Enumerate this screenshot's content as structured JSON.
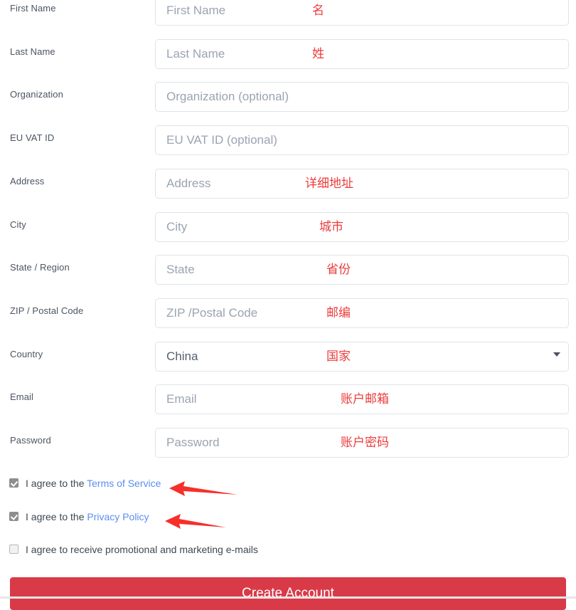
{
  "form": {
    "fields": [
      {
        "label": "First Name",
        "placeholder": "First Name",
        "value": "",
        "annotation": "名",
        "type": "text",
        "name": "first-name"
      },
      {
        "label": "Last Name",
        "placeholder": "Last Name",
        "value": "",
        "annotation": "姓",
        "type": "text",
        "name": "last-name"
      },
      {
        "label": "Organization",
        "placeholder": "Organization (optional)",
        "value": "",
        "annotation": "",
        "type": "text",
        "name": "organization"
      },
      {
        "label": "EU VAT ID",
        "placeholder": "EU VAT ID (optional)",
        "value": "",
        "annotation": "",
        "type": "text",
        "name": "eu-vat-id"
      },
      {
        "label": "Address",
        "placeholder": "Address",
        "value": "",
        "annotation": "详细地址",
        "type": "text",
        "name": "address"
      },
      {
        "label": "City",
        "placeholder": "City",
        "value": "",
        "annotation": "城市",
        "type": "text",
        "name": "city"
      },
      {
        "label": "State / Region",
        "placeholder": "State",
        "value": "",
        "annotation": "省份",
        "type": "text",
        "name": "state-region"
      },
      {
        "label": "ZIP / Postal Code",
        "placeholder": "ZIP /Postal Code",
        "value": "",
        "annotation": "邮编",
        "type": "text",
        "name": "zip-postal-code"
      },
      {
        "label": "Country",
        "placeholder": "",
        "value": "China",
        "annotation": "国家",
        "type": "select",
        "name": "country"
      },
      {
        "label": "Email",
        "placeholder": "Email",
        "value": "",
        "annotation": "账户邮箱",
        "type": "email",
        "name": "email"
      },
      {
        "label": "Password",
        "placeholder": "Password",
        "value": "",
        "annotation": "账户密码",
        "type": "password",
        "name": "password"
      }
    ]
  },
  "agreements": [
    {
      "prefix": "I agree to the ",
      "link": "Terms of Service",
      "suffix": "",
      "checked": true,
      "name": "terms-of-service"
    },
    {
      "prefix": "I agree to the ",
      "link": "Privacy Policy",
      "suffix": "",
      "checked": true,
      "name": "privacy-policy"
    },
    {
      "prefix": "I agree to receive promotional and marketing e-mails",
      "link": "",
      "suffix": "",
      "checked": false,
      "name": "marketing-emails"
    }
  ],
  "submit": {
    "label": "Create Account"
  },
  "colors": {
    "accent_red": "#d93a48",
    "annotation_red": "#ec3b3b",
    "arrow_red": "#f72f2a",
    "link_blue": "#5b8def",
    "label_gray": "#4b5563",
    "placeholder_gray": "#9aa4b1",
    "border_gray": "#dfe3e8"
  },
  "icons": {
    "dropdown": "chevron-down-icon",
    "arrow_1": "arrow-left-icon",
    "arrow_2": "arrow-left-icon"
  }
}
